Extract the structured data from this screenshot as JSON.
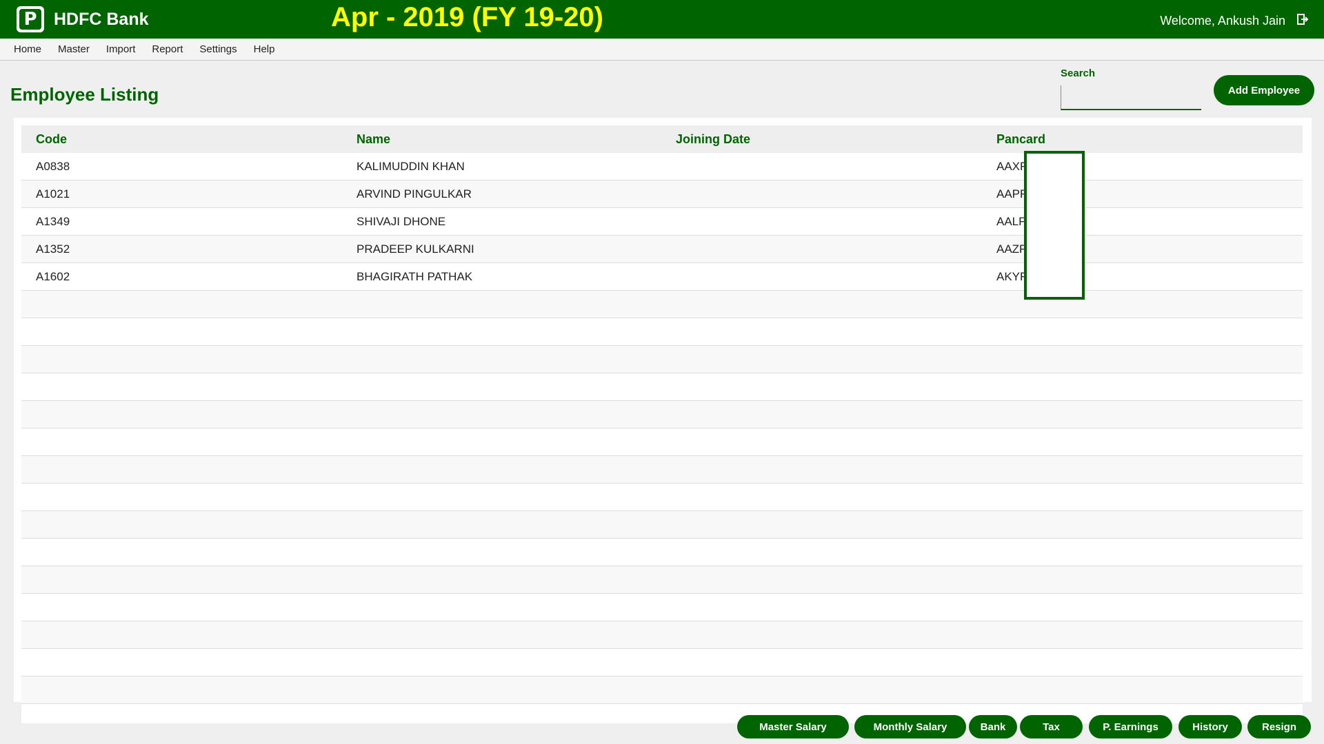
{
  "header": {
    "logo_letter": "P",
    "brand": "HDFC Bank",
    "period": "Apr - 2019 (FY 19-20)",
    "welcome": "Welcome, Ankush Jain",
    "logout_icon": "logout-icon"
  },
  "menu": {
    "items": [
      "Home",
      "Master",
      "Import",
      "Report",
      "Settings",
      "Help"
    ]
  },
  "page": {
    "title": "Employee Listing",
    "search_label": "Search",
    "search_value": "",
    "add_button": "Add Employee"
  },
  "table": {
    "columns": [
      "Code",
      "Name",
      "Joining Date",
      "Pancard"
    ],
    "rows": [
      {
        "code": "A0838",
        "name": "KALIMUDDIN KHAN",
        "joining": "",
        "pancard": "AAXF"
      },
      {
        "code": "A1021",
        "name": "ARVIND PINGULKAR",
        "joining": "",
        "pancard": "AAPF"
      },
      {
        "code": "A1349",
        "name": "SHIVAJI DHONE",
        "joining": "",
        "pancard": "AALF"
      },
      {
        "code": "A1352",
        "name": "PRADEEP KULKARNI",
        "joining": "",
        "pancard": "AAZF"
      },
      {
        "code": "A1602",
        "name": "BHAGIRATH PATHAK",
        "joining": "",
        "pancard": "AKYF"
      }
    ]
  },
  "actions": [
    "Master Salary",
    "Monthly Salary",
    "Bank",
    "Tax",
    "P. Earnings",
    "History",
    "Resign"
  ],
  "colors": {
    "primary": "#006400",
    "period_text": "#ffff00"
  }
}
